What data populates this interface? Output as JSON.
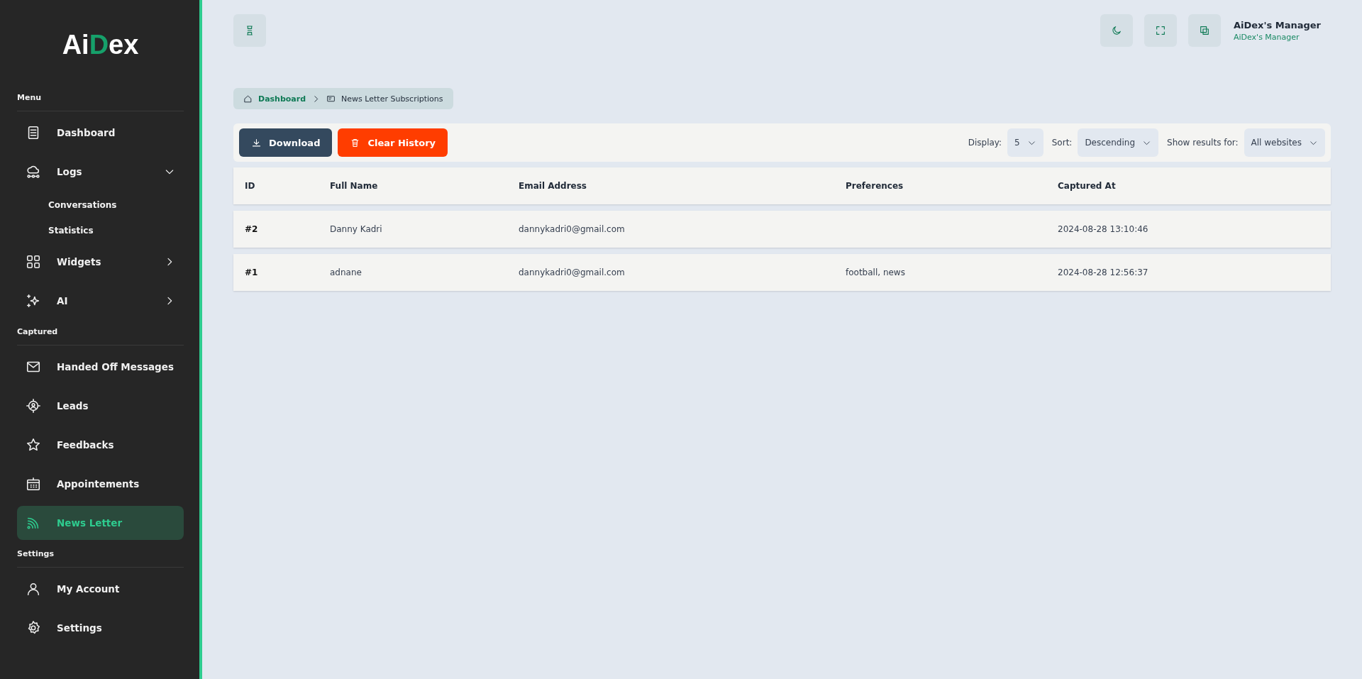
{
  "sidebar": {
    "logo": [
      {
        "text": "Ai",
        "accent": false
      },
      {
        "text": "D",
        "accent": true
      },
      {
        "text": "ex",
        "accent": false
      }
    ],
    "sections": [
      {
        "title": "Menu",
        "items": [
          {
            "label": "Dashboard",
            "selected": false
          },
          {
            "label": "Logs",
            "selected": false,
            "expanded": true,
            "children": [
              {
                "label": "Conversations"
              },
              {
                "label": "Statistics"
              }
            ]
          },
          {
            "label": "Widgets",
            "selected": false,
            "expanded": false
          },
          {
            "label": "AI",
            "selected": false,
            "expanded": false
          }
        ]
      },
      {
        "title": "Captured",
        "items": [
          {
            "label": "Handed Off Messages",
            "selected": false
          },
          {
            "label": "Leads",
            "selected": false
          },
          {
            "label": "Feedbacks",
            "selected": false
          },
          {
            "label": "Appointements",
            "selected": false
          },
          {
            "label": "News Letter",
            "selected": true
          }
        ]
      },
      {
        "title": "Settings",
        "items": [
          {
            "label": "My Account",
            "selected": false
          },
          {
            "label": "Settings",
            "selected": false
          }
        ]
      }
    ]
  },
  "topbar": {
    "user_name": "AiDex's Manager",
    "user_role": "AiDex's Manager"
  },
  "breadcrumb": [
    {
      "label": "Dashboard",
      "current": false
    },
    {
      "label": "News Letter Subscriptions",
      "current": true
    }
  ],
  "toolbar": {
    "buttons": [
      {
        "label": "Download",
        "kind": "download"
      },
      {
        "label": "Clear History",
        "kind": "danger"
      }
    ],
    "filters": [
      {
        "label": "Display:",
        "value": "5"
      },
      {
        "label": "Sort:",
        "value": "Descending"
      },
      {
        "label": "Show results for:",
        "value": "All websites"
      }
    ]
  },
  "table": {
    "columns": [
      "ID",
      "Full Name",
      "Email Address",
      "Preferences",
      "Captured At"
    ],
    "rows": [
      [
        "#2",
        "Danny Kadri",
        "dannykadri0@gmail.com",
        "",
        "2024-08-28 13:10:46"
      ],
      [
        "#1",
        "adnane",
        "dannykadri0@gmail.com",
        "football, news",
        "2024-08-28 12:56:37"
      ]
    ]
  }
}
